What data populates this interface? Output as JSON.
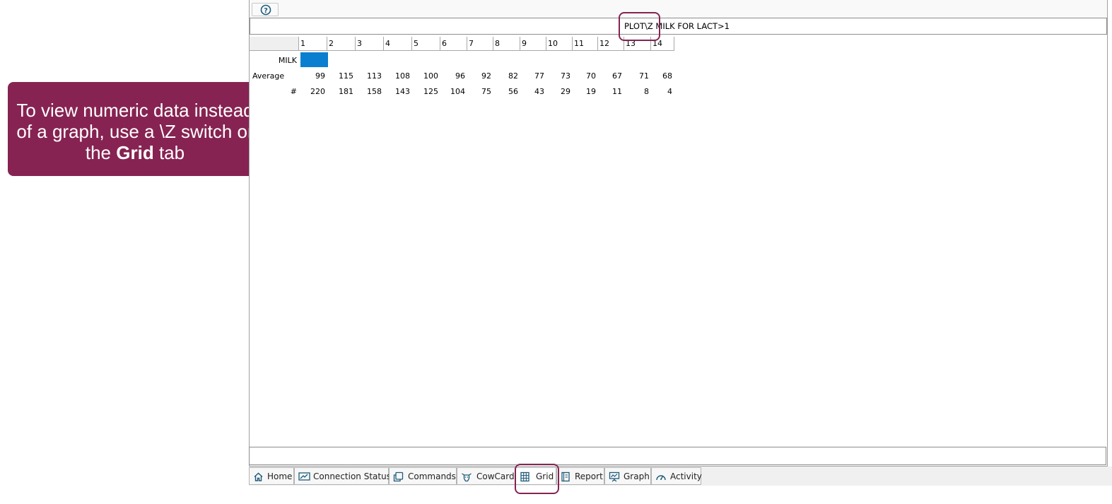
{
  "callout": {
    "line1": "To view numeric data instead",
    "line2": "of a graph, use a \\Z switch or",
    "line3_pre": "the",
    "line3_bold": "Grid",
    "line3_post": "tab"
  },
  "command": {
    "text": "PLOT\\Z MILK FOR LACT>1"
  },
  "grid": {
    "columns": [
      "1",
      "2",
      "3",
      "4",
      "5",
      "6",
      "7",
      "8",
      "9",
      "10",
      "11",
      "12",
      "13",
      "14"
    ],
    "rows": [
      {
        "label": "MILK",
        "values": []
      },
      {
        "label": "Average",
        "values": [
          "99",
          "115",
          "113",
          "108",
          "100",
          "96",
          "92",
          "82",
          "77",
          "73",
          "70",
          "67",
          "71",
          "68"
        ]
      },
      {
        "label": "#",
        "values": [
          "220",
          "181",
          "158",
          "143",
          "125",
          "104",
          "75",
          "56",
          "43",
          "29",
          "19",
          "11",
          "8",
          "4"
        ]
      }
    ]
  },
  "tabs": [
    {
      "label": "Home",
      "icon": "home-icon"
    },
    {
      "label": "Connection Status",
      "icon": "connection-status-icon"
    },
    {
      "label": "Commands",
      "icon": "commands-icon"
    },
    {
      "label": "CowCard",
      "icon": "cow-icon"
    },
    {
      "label": "Grid",
      "icon": "grid-icon"
    },
    {
      "label": "Report",
      "icon": "report-icon"
    },
    {
      "label": "Graph",
      "icon": "graph-icon"
    },
    {
      "label": "Activity",
      "icon": "activity-gauge-icon"
    }
  ],
  "colors": {
    "callout": "#862352",
    "highlight": "#862352",
    "milk_cell": "#0a7fd0",
    "icon": "#1c5b7a"
  }
}
